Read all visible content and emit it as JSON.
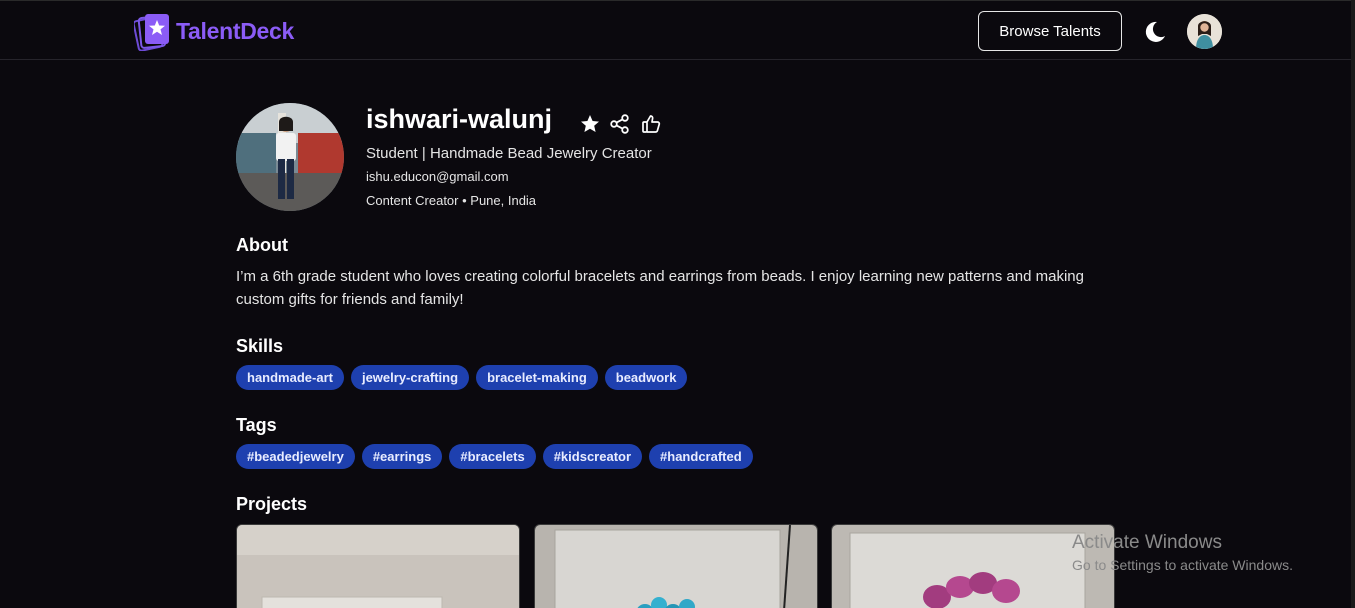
{
  "app": {
    "name": "TalentDeck",
    "brand_color": "#8b5cf6"
  },
  "header": {
    "browse_label": "Browse Talents",
    "theme_icon": "moon-icon",
    "avatar_icon": "user-avatar"
  },
  "profile": {
    "username": "ishwari-walunj",
    "headline": "Student | Handmade Bead Jewelry Creator",
    "email": "ishu.educon@gmail.com",
    "meta": "Content Creator • Pune, India",
    "actions": [
      "star-icon",
      "share-icon",
      "thumbs-up-icon"
    ]
  },
  "about": {
    "title": "About",
    "text": "I’m a 6th grade student who loves creating colorful bracelets and earrings from beads. I enjoy learning new patterns and making custom gifts for friends and family!"
  },
  "skills": {
    "title": "Skills",
    "items": [
      "handmade-art",
      "jewelry-crafting",
      "bracelet-making",
      "beadwork"
    ],
    "chip_color": "#1e40af"
  },
  "tags": {
    "title": "Tags",
    "items": [
      "#beadedjewelry",
      "#earrings",
      "#bracelets",
      "#kidscreator",
      "#handcrafted"
    ]
  },
  "projects": {
    "title": "Projects",
    "count": 3
  },
  "os_watermark": {
    "line1": "Activate Windows",
    "line2": "Go to Settings to activate Windows."
  }
}
